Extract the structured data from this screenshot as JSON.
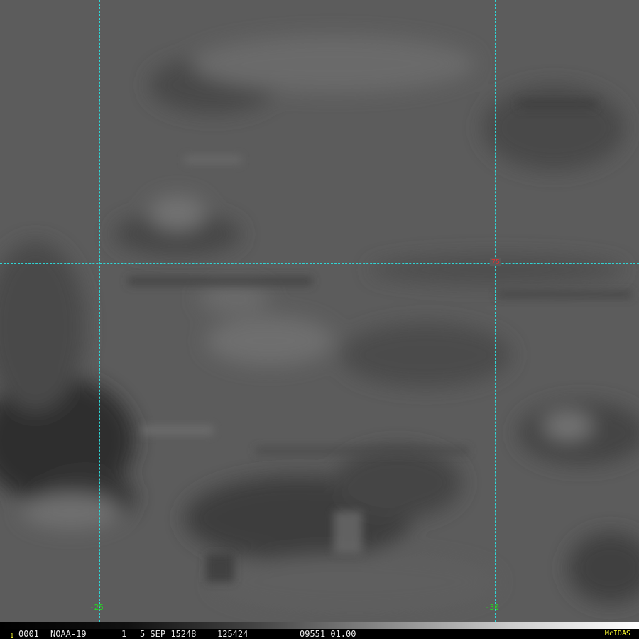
{
  "map": {
    "longitude_labels": [
      "-25",
      "-30"
    ],
    "latitude_labels": [
      "75"
    ],
    "gridline_color": "#2fd6d6",
    "longitude_label_color": "#22dd22",
    "latitude_label_color": "#e03030"
  },
  "status_bar": {
    "frame_number": "1",
    "frame_id": "0001",
    "satellite": "NOAA-19",
    "band": "1",
    "date": "5 SEP 15248",
    "time": "125424",
    "center": "09551 01.00",
    "software": "McIDAS",
    "text_color": "#e8e8e8",
    "brand_color": "#ffff33"
  }
}
